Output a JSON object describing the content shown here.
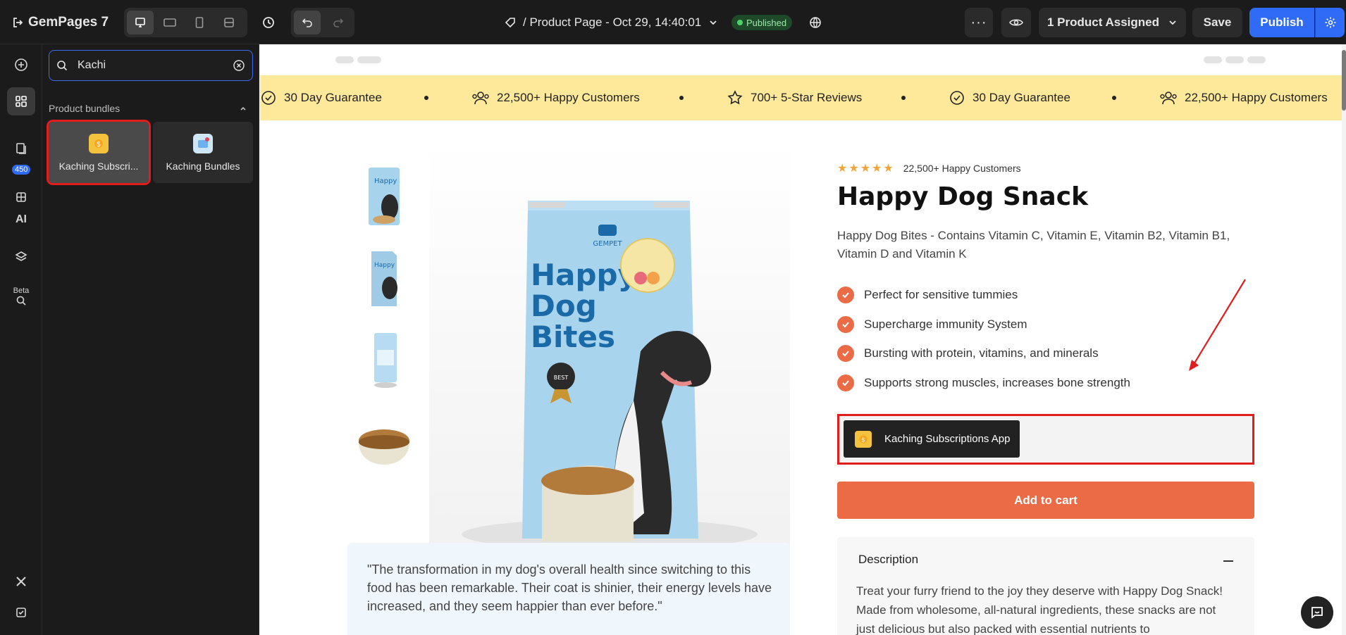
{
  "app": {
    "name": "GemPages 7"
  },
  "header": {
    "page_title": "/ Product Page - Oct 29, 14:40:01",
    "status_badge": "Published",
    "assigned_label": "1 Product Assigned",
    "save_label": "Save",
    "publish_label": "Publish"
  },
  "rail": {
    "badge_count": "450",
    "ai_label": "AI",
    "beta_label": "Beta"
  },
  "panel": {
    "search_value": "Kachi",
    "category": "Product bundles",
    "cards": [
      {
        "label": "Kaching Subscri...",
        "icon": "kaching-subscriptions-icon",
        "selected": true
      },
      {
        "label": "Kaching Bundles",
        "icon": "kaching-bundles-icon",
        "selected": false
      }
    ]
  },
  "canvas": {
    "marquee": [
      "30 Day Guarantee",
      "22,500+ Happy Customers",
      "700+ 5-Star Reviews",
      "30 Day Guarantee",
      "22,500+ Happy Customers"
    ],
    "product": {
      "rating_text": "22,500+ Happy Customers",
      "title": "Happy Dog Snack",
      "description": "Happy Dog Bites - Contains Vitamin C, Vitamin E, Vitamin B2, Vitamin B1, Vitamin D and Vitamin K",
      "features": [
        "Perfect for sensitive tummies",
        "Supercharge immunity System",
        "Bursting with protein, vitamins, and minerals",
        "Supports strong muscles, increases bone strength"
      ],
      "kaching_label": "Kaching Subscriptions App",
      "add_to_cart": "Add to cart",
      "description_heading": "Description",
      "description_body": "Treat your furry friend to the joy they deserve with Happy Dog Snack! Made from wholesome, all-natural ingredients, these snacks are not just delicious but also packed with essential nutrients to"
    },
    "package": {
      "brand": "GEMPET",
      "line1": "Happy",
      "line2": "Dog",
      "line3": "Bites",
      "badge": "BEST"
    },
    "review": "\"The transformation in my dog's overall health since switching to this food has been remarkable. Their coat is shinier, their energy levels have increased, and they seem happier than ever before.\""
  },
  "colors": {
    "accent": "#ea6b46",
    "publish": "#2f6bf6",
    "marquee": "#fde999",
    "highlight": "#e11d1d"
  }
}
